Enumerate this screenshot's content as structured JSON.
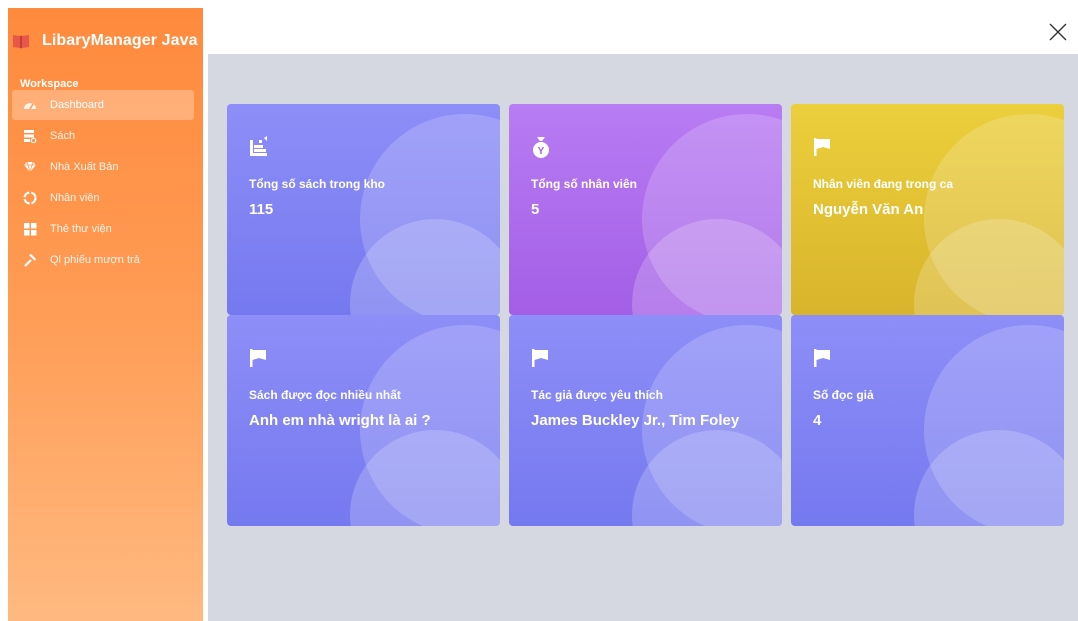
{
  "app": {
    "title": "LibaryManager Java"
  },
  "sidebar": {
    "section": "Workspace",
    "items": [
      {
        "label": "Dashboard",
        "icon": "gauge-icon",
        "active": true
      },
      {
        "label": "Sách",
        "icon": "books-icon"
      },
      {
        "label": "Nhà Xuất Bản",
        "icon": "gem-icon"
      },
      {
        "label": "Nhân viên",
        "icon": "team-icon"
      },
      {
        "label": "Thẻ thư viện",
        "icon": "grid-icon"
      },
      {
        "label": "Ql phiếu mượn trả",
        "icon": "hammer-icon"
      }
    ]
  },
  "cards": [
    {
      "label": "Tổng số sách trong kho",
      "value": "115",
      "icon": "chart-bar-icon",
      "color": "#8486f5"
    },
    {
      "label": "Tổng số nhân viên",
      "value": "5",
      "icon": "money-bag-icon",
      "color": "#b070f0"
    },
    {
      "label": "Nhân viên đang trong ca",
      "value": "Nguyễn Văn An",
      "icon": "flag-icon",
      "color": "#e6c535"
    },
    {
      "label": "Sách được đọc nhiều nhất",
      "value": "Anh em nhà wright là ai ?",
      "icon": "flag-icon",
      "color": "#8486f5"
    },
    {
      "label": "Tác giả được yêu thích",
      "value": "James Buckley Jr., Tim Foley",
      "icon": "flag-icon",
      "color": "#8486f5"
    },
    {
      "label": "Số đọc giả",
      "value": "4",
      "icon": "flag-icon",
      "color": "#8486f5"
    }
  ],
  "colors": {
    "sidebar": "#ff8a3d",
    "main_bg": "#d5d8e0"
  }
}
